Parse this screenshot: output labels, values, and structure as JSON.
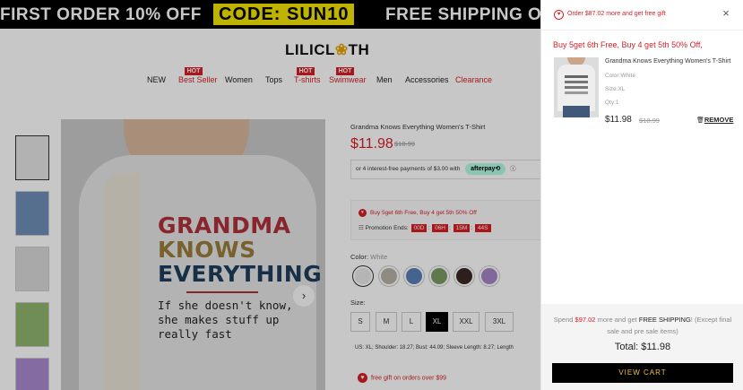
{
  "promo_bar": {
    "part1": "FIRST ORDER 10% OFF",
    "code": "CODE: SUN10",
    "part2": "FREE SHIPPING OV"
  },
  "logo": {
    "left": "LILICL",
    "flower": "❀",
    "right": "TH"
  },
  "nav": {
    "hot_badge": "HOT",
    "items": [
      "NEW",
      "Best Seller",
      "Women",
      "Tops",
      "T-shirts",
      "Swimwear",
      "Men",
      "Accessories",
      "Clearance"
    ]
  },
  "gallery": {
    "artwork": {
      "line1": "GRANDMA",
      "line2": "KNOWS",
      "line3": "EVERYTHING",
      "caption": [
        "If she doesn't know,",
        "she makes stuff up",
        "really fast"
      ]
    },
    "next_icon": "›"
  },
  "product": {
    "title": "Grandma Knows Everything Women's T-Shirt",
    "price": "$11.98",
    "old_price": "$18.99",
    "afterpay_text": "or 4 interest-free payments of $3.00 with",
    "afterpay_brand": "afterpay⟲",
    "info_icon": "ⓘ",
    "promo_line": "Buy 5get 6th Free, Buy 4 get 5th 50% Off",
    "promo_ends_label": "Promotion Ends:",
    "timer": [
      "00D",
      "06H",
      "15M",
      "44S"
    ],
    "color_label": "Color:",
    "color_value": "White",
    "swatch_colors": [
      "#e8e8e8",
      "#b9b2a6",
      "#5a7fb8",
      "#7a9b63",
      "#3a2a24",
      "#a486c8"
    ],
    "size_label": "Size:",
    "sizes": [
      "S",
      "M",
      "L",
      "XL",
      "XXL",
      "3XL"
    ],
    "selected_size": "XL",
    "measure_text": "US: XL;  Shoulder: 18.27;  Bust: 44.09;  Sleeve Length: 8.27;  Length",
    "free_gift": "free gift on orders over $99"
  },
  "cart": {
    "gift_icon": "♥",
    "header_msg": "Order $87.02 more and get free gift",
    "close_icon": "×",
    "promo": "Buy 5get 6th Free, Buy 4 get 5th 50% Off,",
    "item": {
      "name": "Grandma Knows Everything Women's T-Shirt",
      "color": "Color:White",
      "size": "Size:XL",
      "qty": "Qty:1",
      "price": "$11.98",
      "old_price": "$18.99",
      "trash_icon": "🗑",
      "remove": "REMOVE"
    },
    "ship_pre": "Spend ",
    "ship_amount": "$97.02",
    "ship_mid": " more and get ",
    "ship_bold": "FREE SHIPPING",
    "ship_post": "! (Except final sale and pre sale items)",
    "total_label": "Total:",
    "total_value": "$11.98",
    "view_cart": "VIEW CART"
  },
  "colors": {
    "accent_red": "#d61f26",
    "promo_yellow": "#f5e600",
    "afterpay_mint": "#b2fce4",
    "cta_text": "#f0c14b"
  }
}
